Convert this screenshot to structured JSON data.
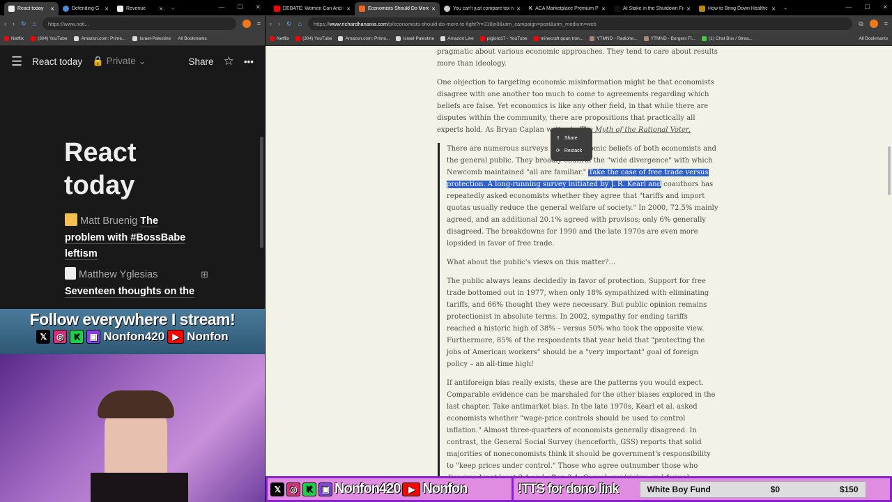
{
  "left_window": {
    "tabs": [
      {
        "label": "React today",
        "active": true
      },
      {
        "label": "Defending G"
      },
      {
        "label": "Revenue"
      }
    ],
    "url": "https://www.noti...",
    "bookmarks": [
      "Netflix",
      "(304) YouTube",
      "Amazon.com: Prime...",
      "Israel-Palestine"
    ],
    "all_bookmarks": "All Bookmarks",
    "notion": {
      "breadcrumb": "React today",
      "privacy": "Private",
      "share": "Share",
      "title": "React today",
      "entries": [
        {
          "author": "Matt Bruenig",
          "title": "The problem with #BossBabe leftism"
        },
        {
          "author": "Matthew Yglesias",
          "title": "Seventeen thoughts on the"
        }
      ]
    }
  },
  "right_window": {
    "tabs": [
      {
        "label": "DEBATE: Women Can And Sh"
      },
      {
        "label": "Economists Should Do More",
        "active": true
      },
      {
        "label": "You can't just compare tax ra"
      },
      {
        "label": "ACA Marketplace Premium P"
      },
      {
        "label": "At Stake in the Shutdown Fig"
      },
      {
        "label": "How to Bring Down Healthc"
      }
    ],
    "url_prefix": "https://",
    "url_domain": "www.richardhanania.com",
    "url_path": "/p/economists-should-do-more-to-fight?r=318jn8&utm_campaign=post&utm_medium=web",
    "bookmarks": [
      "Netflix",
      "(304) YouTube",
      "Amazon.com: Prime...",
      "Israel-Palestine",
      "Amazon Live",
      "piglord17 - YouTube",
      "minecraft quan tron...",
      "YTMND - Radiohe...",
      "YTMND - Burgers Fl...",
      "(1) Chat Box / Strea..."
    ],
    "all_bookmarks": "All Bookmarks",
    "article": {
      "p0": "pragmatic about various economic approaches. They tend to care about results more than ideology.",
      "p1": "One objection to targeting economic misinformation might be that economists disagree with one another too much to come to agreements regarding which beliefs are false. Yet economics is like any other field, in that while there are disputes within the community, there are propositions that practically all experts hold. As Bryan Caplan writes in ",
      "p1_book": "The Myth of the Rational Voter,",
      "q1a": "There are numerous surveys of the economic beliefs of both economists and the general public. They broadly confirm the \"wide divergence\" with which Newcomb maintained \"all are familiar.\" ",
      "q1_highlight": "Take the case of free trade versus protection. A long-running survey initiated by J. R. Kearl and",
      "q1b": " coauthors has repeatedly asked economists whether they agree that \"tariffs and import quotas usually reduce the general welfare of society.\" In 2000, 72.5% mainly agreed, and an additional 20.1% agreed with provisos; only 6% generally disagreed. The breakdowns for 1990 and the late 1970s are even more lopsided in favor of free trade.",
      "q2": "What about the public's views on this matter?...",
      "q3": "The public always leans decidedly in favor of protection. Support for free trade bottomed out in 1977, when only 18% sympathized with eliminating tariffs, and 66% thought they were necessary. But public opinion remains protectionist in absolute terms. In 2002, sympathy for ending tariffs reached a historic high of 38% – versus 50% who took the opposite view. Furthermore, 85% of the respondents that year held that \"protecting the jobs of American workers\" should be a \"very important\" goal of foreign policy – an all-time high!",
      "q4": "If antiforeign bias really exists, these are the patterns you would expect. Comparable evidence can be marshaled for the other biases explored in the last chapter. Take antimarket bias. In the late 1970s, Kearl et al. asked economists whether \"wage-price controls should be used to control inflation.\" Almost three-quarters of economists generally disagreed. In contrast, the General Social Survey (henceforth, GSS) reports that solid majorities of noneconomists think it should be government's responsibility to \"keep prices under control.\" Those who agree outnumber those who disagree by at least 2:1 and often 3:1. Casual empiricism and formal empiricism are in sync."
    },
    "popup": {
      "share": "Share",
      "restack": "Restack"
    }
  },
  "overlay": {
    "follow": "Follow everywhere I stream!",
    "handle": "Nonfon420",
    "yt": "Nonfon",
    "tts": "!TTS for dono link",
    "fund": {
      "name": "White Boy Fund",
      "current": "$0",
      "goal": "$150",
      "progress": 0
    }
  }
}
